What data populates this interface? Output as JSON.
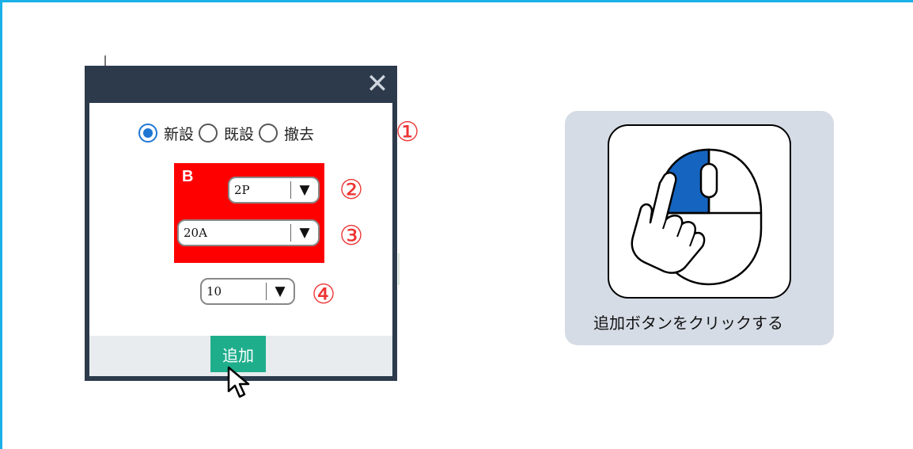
{
  "dialog": {
    "close_symbol": "✕",
    "type_options": [
      {
        "label": "新設",
        "checked": true
      },
      {
        "label": "既設",
        "checked": false
      },
      {
        "label": "撤去",
        "checked": false
      }
    ],
    "breaker_label": "B",
    "poles": {
      "value": "2P",
      "arrow": "▼"
    },
    "ampere": {
      "value": "20A",
      "arrow": "▼"
    },
    "quantity": {
      "value": "10",
      "arrow": "▼"
    },
    "add_button": "追加"
  },
  "markers": [
    "①",
    "②",
    "③",
    "④"
  ],
  "instruction": {
    "text": "追加ボタンをクリックする"
  },
  "colors": {
    "frame": "#1ab0e8",
    "dialog_header": "#2c3a4b",
    "radio_selected": "#1f77d4",
    "breaker_box": "#ff0000",
    "add_button": "#1fae8c",
    "markers": "#e33333",
    "card": "#d6dce6",
    "mouse_button": "#1565c0"
  },
  "icons": [
    "close-icon",
    "chevron-down-icon",
    "mouse-pointer-icon",
    "mouse-click-icon"
  ]
}
